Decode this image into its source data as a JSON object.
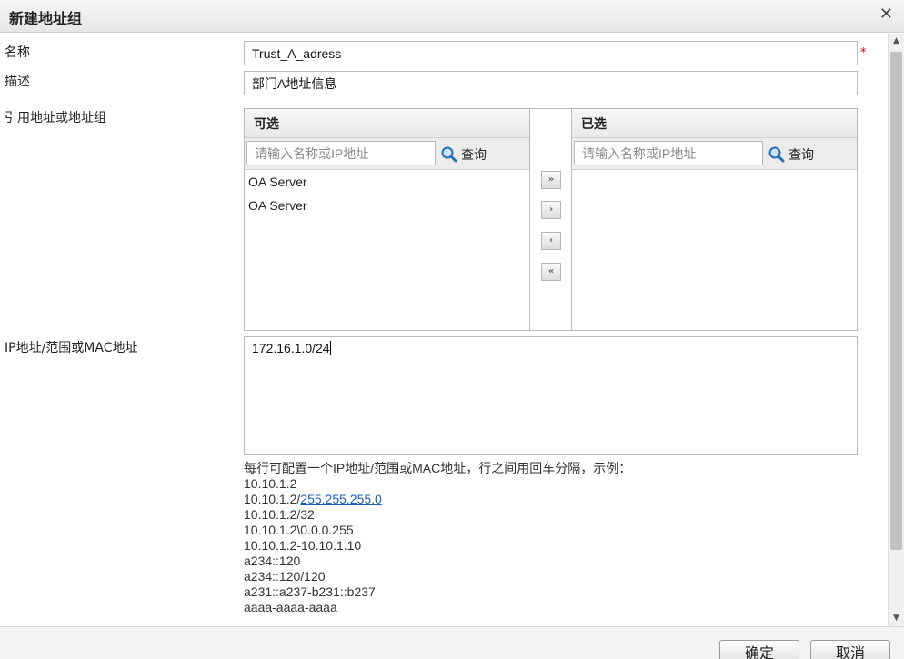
{
  "dialog": {
    "title": "新建地址组",
    "close_icon": "close-icon"
  },
  "form": {
    "name_label": "名称",
    "name_value": "Trust_A_adress",
    "required_mark": "*",
    "desc_label": "描述",
    "desc_value": "部门A地址信息",
    "ref_label": "引用地址或地址组",
    "ip_label": "IP地址/范围或MAC地址",
    "ip_value": "172.16.1.0/24"
  },
  "picker": {
    "available_title": "可选",
    "selected_title": "已选",
    "search_placeholder": "请输入名称或IP地址",
    "search_label": "查询",
    "available_items": [
      "OA  Server",
      "OA Server"
    ],
    "move_all_right": "»",
    "move_right": "›",
    "move_left": "‹",
    "move_all_left": "«"
  },
  "hint": {
    "intro": "每行可配置一个IP地址/范围或MAC地址，行之间用回车分隔，示例：",
    "ex1": "10.10.1.2",
    "ex2_prefix": "10.10.1.2/",
    "ex2_link": "255.255.255.0",
    "ex3": "10.10.1.2/32",
    "ex4": "10.10.1.2\\0.0.0.255",
    "ex5": "10.10.1.2-10.10.1.10",
    "ex6": "a234::120",
    "ex7": "a234::120/120",
    "ex8": "a231::a237-b231::b237",
    "ex9": "aaaa-aaaa-aaaa"
  },
  "footer": {
    "ok_label": "确定",
    "cancel_label": "取消"
  },
  "colors": {
    "link": "#1f5fb8",
    "required": "#dd0000"
  }
}
